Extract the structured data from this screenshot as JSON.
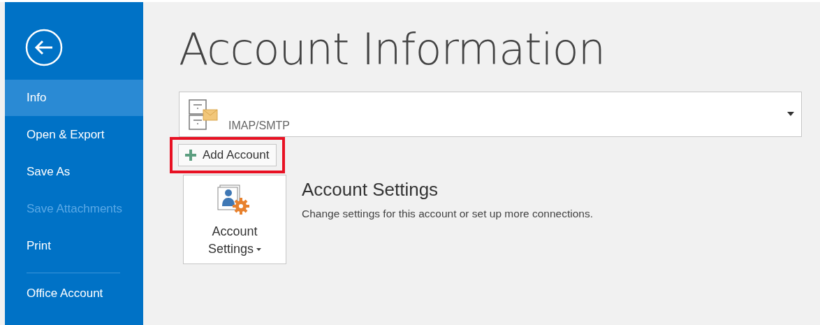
{
  "sidebar": {
    "items": [
      {
        "label": "Info",
        "selected": true,
        "disabled": false,
        "separator_before": false
      },
      {
        "label": "Open & Export",
        "selected": false,
        "disabled": false,
        "separator_before": false
      },
      {
        "label": "Save As",
        "selected": false,
        "disabled": false,
        "separator_before": false
      },
      {
        "label": "Save Attachments",
        "selected": false,
        "disabled": true,
        "separator_before": false
      },
      {
        "label": "Print",
        "selected": false,
        "disabled": false,
        "separator_before": false
      },
      {
        "label": "Office Account",
        "selected": false,
        "disabled": false,
        "separator_before": true
      }
    ]
  },
  "page_title": "Account Information",
  "account_selector": {
    "value": "IMAP/SMTP"
  },
  "add_account": {
    "label": "Add Account",
    "highlighted": true
  },
  "account_settings": {
    "button_lines": [
      "Account",
      "Settings"
    ],
    "title": "Account Settings",
    "description": "Change settings for this account or set up more connections."
  }
}
